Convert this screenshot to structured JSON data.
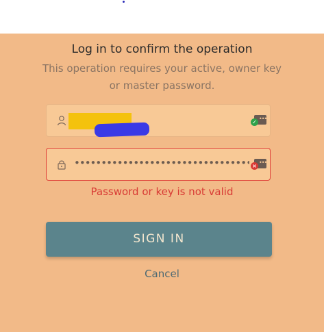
{
  "dialog": {
    "title": "Log in to confirm the operation",
    "subtitle": "This operation requires your active, owner key or master password.",
    "username_field": {
      "value": "",
      "icon": "user-icon",
      "status": "valid"
    },
    "password_field": {
      "value": "••••••••••••••••••••••••••••••••••••",
      "icon": "lock-icon",
      "status": "invalid"
    },
    "error_message": "Password or key is not valid",
    "signin_label": "SIGN IN",
    "cancel_label": "Cancel"
  },
  "colors": {
    "panel_background": "#f2ba88",
    "field_background": "#f8c996",
    "button_background": "#5b848c",
    "error": "#d83b35",
    "valid": "#2fa24a"
  }
}
